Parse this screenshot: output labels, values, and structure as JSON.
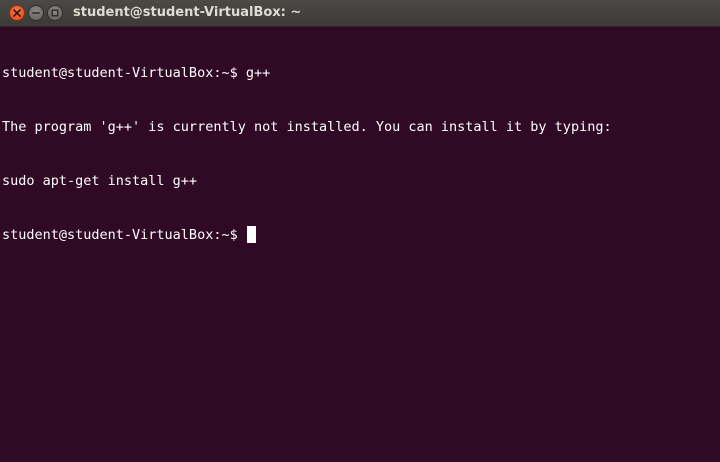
{
  "window": {
    "title": "student@student-VirtualBox: ~"
  },
  "terminal": {
    "lines": [
      "student@student-VirtualBox:~$ g++",
      "The program 'g++' is currently not installed. You can install it by typing:",
      "sudo apt-get install g++"
    ],
    "prompt": "student@student-VirtualBox:~$ "
  },
  "colors": {
    "background": "#300a24",
    "text": "#ffffff",
    "titlebar": "#3c3b37",
    "close_button": "#df4a16"
  },
  "icons": {
    "close": "close-icon",
    "minimize": "minimize-icon",
    "maximize": "maximize-icon"
  }
}
